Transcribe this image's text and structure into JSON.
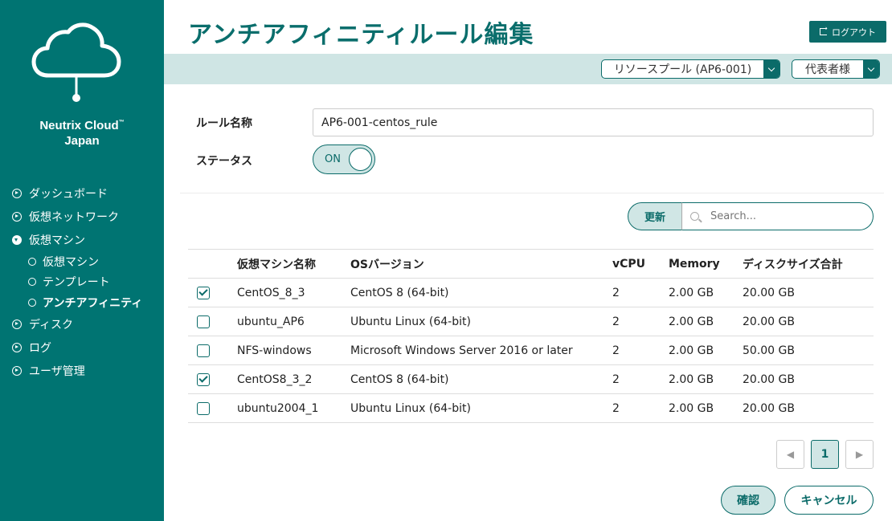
{
  "brand": {
    "line1": "Neutrix Cloud",
    "tm": "™",
    "line2": "Japan"
  },
  "nav": {
    "dashboard": "ダッシュボード",
    "network": "仮想ネットワーク",
    "vm": "仮想マシン",
    "vm_sub": [
      "仮想マシン",
      "テンプレート",
      "アンチアフィニティ"
    ],
    "disk": "ディスク",
    "log": "ログ",
    "users": "ユーザ管理"
  },
  "header": {
    "title": "アンチアフィニティルール編集",
    "logout": "ログアウト",
    "pool_select": "リソースプール (AP6-001)",
    "role_select": "代表者様"
  },
  "form": {
    "rule_name_label": "ルール名称",
    "rule_name_value": "AP6-001-centos_rule",
    "status_label": "ステータス",
    "status_value": "ON"
  },
  "search": {
    "refresh": "更新",
    "placeholder": "Search..."
  },
  "table": {
    "headers": [
      "仮想マシン名称",
      "OSバージョン",
      "vCPU",
      "Memory",
      "ディスクサイズ合計"
    ],
    "rows": [
      {
        "checked": true,
        "name": "CentOS_8_3",
        "os": "CentOS 8 (64-bit)",
        "vcpu": "2",
        "memory": "2.00 GB",
        "disk": "20.00 GB"
      },
      {
        "checked": false,
        "name": "ubuntu_AP6",
        "os": "Ubuntu Linux (64-bit)",
        "vcpu": "2",
        "memory": "2.00 GB",
        "disk": "20.00 GB"
      },
      {
        "checked": false,
        "name": "NFS-windows",
        "os": "Microsoft Windows Server 2016 or later",
        "vcpu": "2",
        "memory": "2.00 GB",
        "disk": "50.00 GB"
      },
      {
        "checked": true,
        "name": "CentOS8_3_2",
        "os": "CentOS 8 (64-bit)",
        "vcpu": "2",
        "memory": "2.00 GB",
        "disk": "20.00 GB"
      },
      {
        "checked": false,
        "name": "ubuntu2004_1",
        "os": "Ubuntu Linux (64-bit)",
        "vcpu": "2",
        "memory": "2.00 GB",
        "disk": "20.00 GB"
      }
    ]
  },
  "pagination": {
    "prev": "◀",
    "current": "1",
    "next": "▶"
  },
  "actions": {
    "confirm": "確認",
    "cancel": "キャンセル"
  },
  "colors": {
    "sidebar": "#007472",
    "accent": "#0b6b69",
    "accent_light": "#d0e6e5"
  }
}
